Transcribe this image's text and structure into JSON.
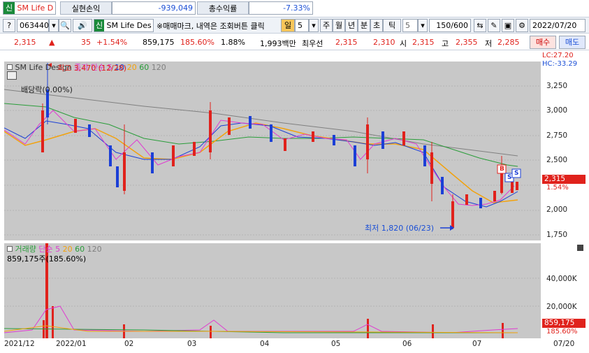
{
  "top": {
    "shin_icon": "신",
    "stock_name": "SM Life D",
    "pnl_label": "실현손익",
    "pnl_value": "-939,049",
    "return_label": "총수익률",
    "return_value": "-7.33%"
  },
  "toolbar": {
    "code": "063440",
    "stock_name": "SM Life Des",
    "memo_text": "※매매마크, 내역은 조회버튼 클릭",
    "period_day": "일",
    "period_num": "5",
    "tabs": [
      "주",
      "월",
      "년",
      "분",
      "초",
      "틱"
    ],
    "tick_num": "5",
    "count": "150",
    "count_max": "/600",
    "date": "2022/07/20"
  },
  "quote": {
    "price": "2,315",
    "arrow": "▲",
    "change": "35",
    "change_pct": "+1.54%",
    "volume": "859,175",
    "volume_ratio": "185.60%",
    "turnover": "1.88%",
    "amount": "1,993백만",
    "best_label": "최우선",
    "ask": "2,315",
    "bid": "2,310",
    "open_label": "시",
    "open": "2,315",
    "high_label": "고",
    "high": "2,355",
    "low_label": "저",
    "low": "2,285",
    "buy": "매수",
    "sell": "매도"
  },
  "chart": {
    "name": "SM Life Design",
    "ma_label": "종가 단순",
    "ma_periods": [
      "5",
      "10",
      "20",
      "60",
      "120"
    ],
    "lc": "LC:27.20",
    "hc": "HC:-33.29",
    "high_note": "최고 3,470 (12/28)",
    "dividend": "배당락(0.00%)",
    "low_note": "최저 1,820 (06/23)",
    "price_tag": "2,315",
    "pct_tag": "1.54%",
    "y_ticks": [
      "3,250",
      "3,000",
      "2,750",
      "2,500",
      "2,250",
      "2,000",
      "1,750"
    ],
    "marks": [
      "B",
      "S",
      "S"
    ]
  },
  "volume": {
    "label": "거래량",
    "ma_label": "단순",
    "ma_periods": [
      "5",
      "20",
      "60",
      "120"
    ],
    "value_note": "859,175주(185.60%)",
    "y_ticks": [
      "40,000K",
      "20,000K"
    ],
    "tag_value": "859,175",
    "tag_pct": "185.60%"
  },
  "x_ticks": [
    "2021/12",
    "2022/01",
    "02",
    "03",
    "04",
    "05",
    "06",
    "07",
    "07/20"
  ],
  "chart_data": {
    "type": "candlestick",
    "price_range": [
      1700,
      3470
    ],
    "candles_approx_close": [
      2820,
      2780,
      2700,
      2650,
      2600,
      2480,
      2420,
      2560,
      3050,
      3150,
      2950,
      2900,
      2850,
      2800,
      2780,
      2760,
      2720,
      2650,
      2600,
      2500,
      2350,
      2250,
      2400,
      2560,
      2620,
      2550,
      2480,
      2400,
      2350,
      2400,
      2450,
      2480,
      2500,
      2540,
      2600,
      2580,
      2700,
      2800,
      2850,
      2830,
      2880,
      2900,
      2880,
      2920,
      2950,
      2900,
      2800,
      2700,
      2650,
      2700,
      2720,
      2700,
      2720,
      2750,
      2740,
      2760,
      2700,
      2650,
      2500,
      2480,
      2550,
      2800,
      2650,
      2600,
      2550,
      2600,
      2700,
      2750,
      2700,
      2650,
      2600,
      2500,
      2400,
      2300,
      2200,
      2050,
      1900,
      2000,
      2050,
      2100,
      2020,
      2080,
      2100,
      2150,
      2200,
      2300,
      2315
    ]
  }
}
